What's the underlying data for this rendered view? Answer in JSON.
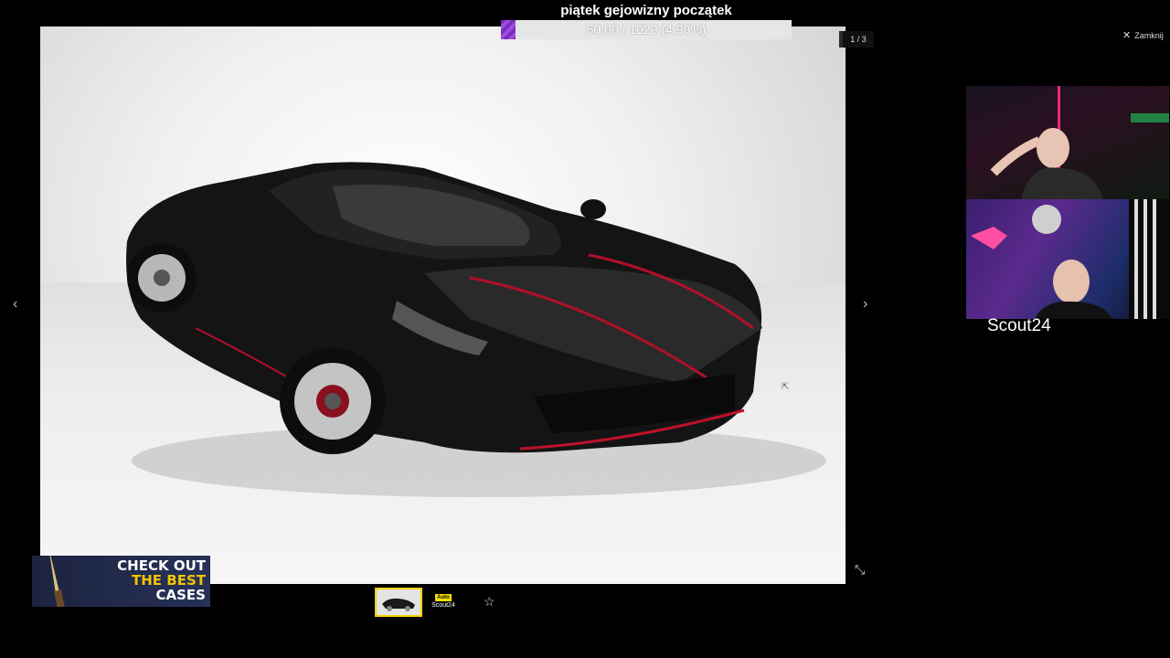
{
  "goal": {
    "title": "piątek gejowizny początek",
    "progress_text": "50.00 / 1020 (4.90%)",
    "progress_fraction": 0.049,
    "fill_color": "#7b2cbf"
  },
  "gallery": {
    "counter": "1 / 3",
    "close_label": "Zamknij",
    "close_icon": "x-icon",
    "prev_icon": "chevron-left-icon",
    "next_icon": "chevron-right-icon",
    "fullscreen_icon": "compress-icon",
    "favorite_icon": "star-icon"
  },
  "brand": {
    "badge": "Auto",
    "name": "Scout24"
  },
  "webcam": {
    "name": "Scout24"
  },
  "ad": {
    "line1": "CHECK OUT",
    "line2": "THE BEST",
    "line3": "CASES"
  }
}
